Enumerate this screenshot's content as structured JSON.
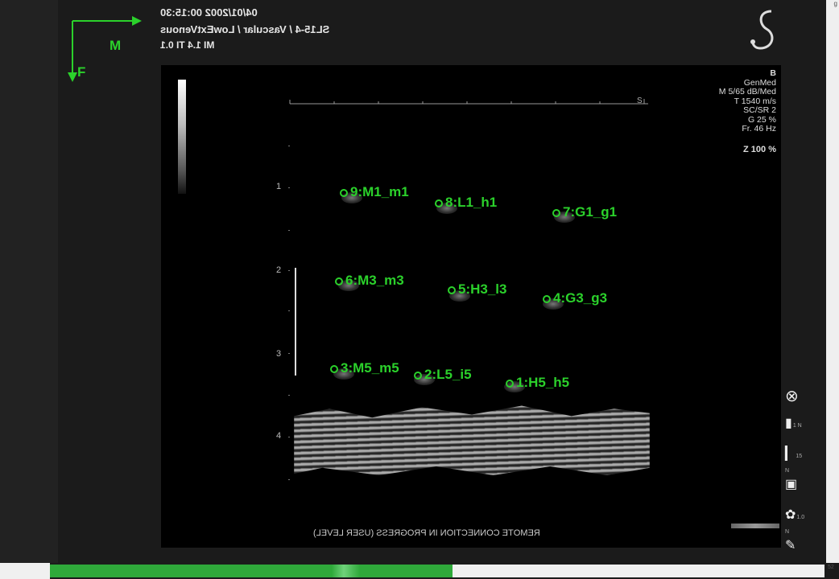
{
  "header": {
    "datetime": "04/01/2002 00:15:30",
    "probe_preset": "SL15-4 / Vascular / LowExtVenous",
    "indices": "MI 1.4  TI 0.1"
  },
  "axes": {
    "m_label": "M",
    "f_label": "F"
  },
  "corner_text": "g",
  "params": {
    "mode": "B",
    "lines": [
      "GenMed",
      "M 5/65 dB/Med",
      "T 1540 m/s",
      "SC/SR 2",
      "G 25 %",
      "Fr. 46 Hz"
    ],
    "zoom": "Z 100 %"
  },
  "depth_scale": [
    "1",
    "2",
    "3",
    "4"
  ],
  "markers": [
    {
      "label": "9:M1_m1"
    },
    {
      "label": "8:L1_h1"
    },
    {
      "label": "7:G1_g1"
    },
    {
      "label": "6:M3_m3"
    },
    {
      "label": "5:H3_l3"
    },
    {
      "label": "4:G3_g3"
    },
    {
      "label": "3:M5_m5"
    },
    {
      "label": "2:L5_i5"
    },
    {
      "label": "1:H5_h5"
    }
  ],
  "status": "REMOTE CONNECTION IN PROGRESS (USER LEVEL)",
  "tools": {
    "close_icon": "⊗",
    "freeze_icon": "▮",
    "depth_icon": "▎",
    "image_icon": "▣",
    "settings_icon": "✿",
    "brush_icon": "✎",
    "freeze_label": "1 N",
    "depth_label": "15 N",
    "settings_label": "1.0 N"
  },
  "progress": {
    "value": 0.52,
    "label": "52"
  }
}
